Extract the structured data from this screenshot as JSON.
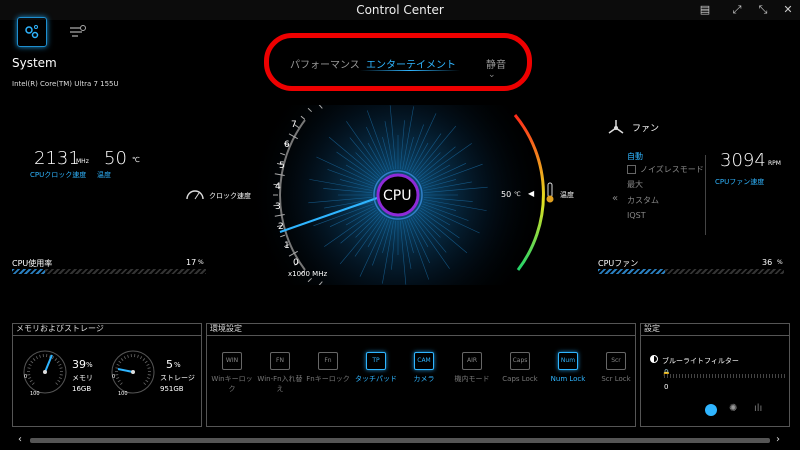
{
  "window": {
    "title": "Control Center"
  },
  "header": {
    "section": "System",
    "cpu_model": "Intel(R) Core(TM) Ultra 7 155U"
  },
  "modes": {
    "items": [
      "パフォーマンス",
      "エンターテイメント",
      "静音"
    ],
    "active": "エンターテイメント"
  },
  "cpu": {
    "clock_value": "2131",
    "clock_unit": "MHz",
    "clock_label": "CPUクロック速度",
    "temp_value": "50",
    "temp_unit": "℃",
    "temp_label": "温度",
    "usage_label": "CPU使用率",
    "usage_value": "17",
    "usage_unit": "%",
    "usage_fraction": 0.17,
    "gauge_center": "CPU",
    "gauge_unit": "x1000 MHz",
    "gauge_ticks": [
      "0",
      "1",
      "2",
      "3",
      "4",
      "5",
      "6",
      "7"
    ],
    "clock_speed_label": "クロック速度",
    "gauge_temp": "50",
    "gauge_temp_unit": "℃",
    "gauge_temp_label": "温度"
  },
  "fan": {
    "title": "ファン",
    "modes": [
      "自動",
      "ノイズレスモード",
      "最大",
      "カスタム",
      "IQST"
    ],
    "active_mode": "自動",
    "speed_value": "3094",
    "speed_unit": "RPM",
    "speed_label": "CPUファン速度",
    "bar_label": "CPUファン",
    "bar_value": "36",
    "bar_unit": "%",
    "bar_fraction": 0.36
  },
  "memory": {
    "title": "メモリおよびストレージ",
    "mem_percent": "39",
    "mem_label": "メモリ",
    "mem_size": "16GB",
    "storage_percent": "5",
    "storage_label": "ストレージ",
    "storage_size": "951GB",
    "gauge_min": "0",
    "gauge_max": "100"
  },
  "env": {
    "title": "環境設定",
    "items": [
      {
        "label": "Winキーロック",
        "icon": "WIN",
        "on": false
      },
      {
        "label": "Win-Fn入れ替え",
        "icon": "FN",
        "on": false
      },
      {
        "label": "Fnキーロック",
        "icon": "Fn",
        "on": false
      },
      {
        "label": "タッチパッド",
        "icon": "TP",
        "on": true
      },
      {
        "label": "カメラ",
        "icon": "CAM",
        "on": true
      },
      {
        "label": "機内モード",
        "icon": "AIR",
        "on": false
      },
      {
        "label": "Caps Lock",
        "icon": "Caps",
        "on": false
      },
      {
        "label": "Num Lock",
        "icon": "Num",
        "on": true
      },
      {
        "label": "Scr Lock",
        "icon": "Scr",
        "on": false
      }
    ]
  },
  "settings": {
    "title": "設定",
    "blue_light_label": "ブルーライトフィルター",
    "slider_value": "0"
  }
}
